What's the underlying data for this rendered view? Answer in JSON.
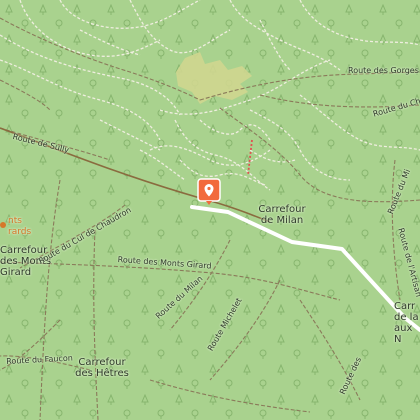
{
  "map": {
    "background": "#a9d28e",
    "road_color": "#8a7a5a",
    "route_color": "#ffffff",
    "marker_color": "#f26a3c"
  },
  "places": {
    "carrefour_milan": "Carrefour\nde Milan",
    "carrefour_hetres": "Carrefour\ndes Hêtres",
    "carrefour_right": "Carr\nde la\naux N",
    "carrefour_monts_girard": "Carrefour\ndes Monts\nGirard",
    "poi_left": "nts\nrards"
  },
  "roads": {
    "route_sully": "Route de Sully",
    "route_cul_chaudron": "Route du Cul de Chaudron",
    "route_monts_girard": "Route des Monts Girard",
    "route_milan": "Route du Milan",
    "route_faucon": "Route du Faucon",
    "route_michelet": "Route Michelet",
    "route_gorges": "Route des Gorges",
    "route_cha": "Route du Cha",
    "route_mi": "Route du Mi",
    "route_lartisan": "Route de l'Artisan",
    "route_es": "Route des"
  },
  "marker": {
    "icon": "location-pin-icon"
  }
}
